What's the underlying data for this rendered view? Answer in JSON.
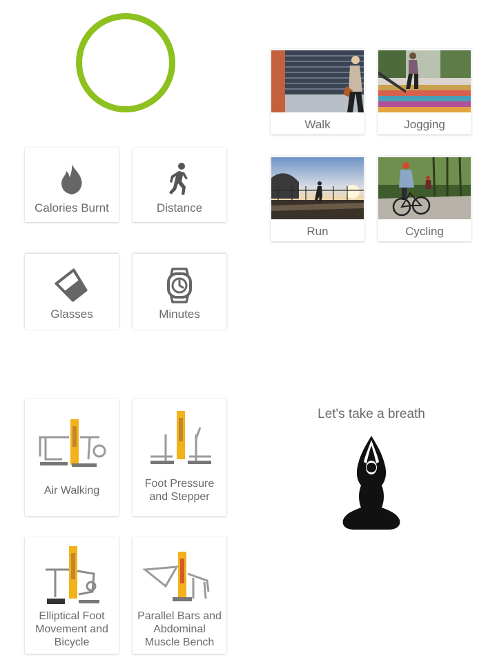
{
  "progress_ring": {
    "color": "#8cc11f"
  },
  "stats": [
    {
      "label": "Calories Burnt",
      "icon": "flame-icon"
    },
    {
      "label": "Distance",
      "icon": "walking-person-icon"
    },
    {
      "label": "Glasses",
      "icon": "glass-icon"
    },
    {
      "label": "Minutes",
      "icon": "watch-icon"
    }
  ],
  "activities": [
    {
      "label": "Walk"
    },
    {
      "label": "Jogging"
    },
    {
      "label": "Run"
    },
    {
      "label": "Cycling"
    }
  ],
  "equipment": [
    {
      "label": "Air Walking"
    },
    {
      "label": "Foot Pressure and Stepper"
    },
    {
      "label": "Elliptical Foot Movement and Bicycle"
    },
    {
      "label": "Parallel Bars and Abdominal Muscle Bench"
    }
  ],
  "breath": {
    "title": "Let's take a breath",
    "icon": "meditation-pose-icon"
  },
  "colors": {
    "accent": "#8cc11f",
    "icon_gray": "#666666",
    "equipment_yellow": "#f2b21c"
  }
}
